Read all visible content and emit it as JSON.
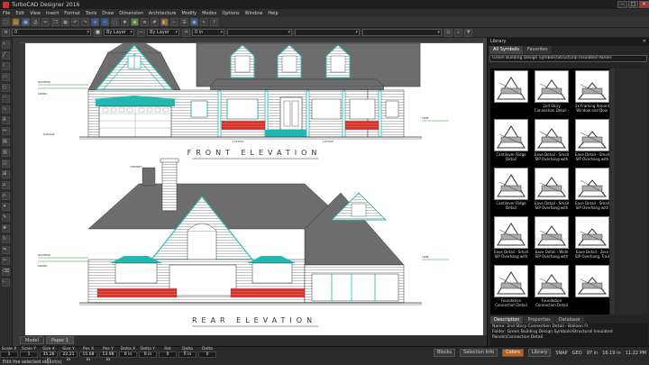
{
  "app": {
    "title": "TurboCAD Designer 2016",
    "window_buttons": [
      "–",
      "□",
      "✕"
    ]
  },
  "menu": [
    "File",
    "Edit",
    "View",
    "Insert",
    "Format",
    "Tools",
    "Draw",
    "Dimension",
    "Architecture",
    "Modify",
    "Modes",
    "Options",
    "Window",
    "Help"
  ],
  "toolbar2": {
    "layer_value": "0",
    "color_value": "By Layer",
    "linetype_value": "By Layer",
    "width_value": "0 in"
  },
  "drawing": {
    "front_title": "FRONT ELEVATION",
    "rear_title": "REAR ELEVATION"
  },
  "page_tabs": [
    "Model",
    "Paper 1"
  ],
  "library": {
    "title": "Library",
    "tabs": [
      "All Symbols",
      "Favorites"
    ],
    "path": "Green Building Design Symbols\\Structural Insulated Panels",
    "items": [
      {
        "label": "",
        "selected": false
      },
      {
        "label": "2nd Story Connection Detail - Standard",
        "selected": false
      },
      {
        "label": "2x Framing Around Window and Door",
        "selected": false
      },
      {
        "label": "Cantilever Ridge Detail",
        "selected": false
      },
      {
        "label": "Eave Detail - Small SIP Overhang with",
        "selected": false
      },
      {
        "label": "Eave Detail - Small SIP Overhang with",
        "selected": false
      },
      {
        "label": "Cantilever Ridge Detail",
        "selected": false
      },
      {
        "label": "Eave Detail - Small SIP Overhang with",
        "selected": false
      },
      {
        "label": "Eave Detail - Small SIP Overhang with",
        "selected": false
      },
      {
        "label": "Eave Detail - Small SIP Overhang with",
        "selected": false
      },
      {
        "label": "Eave Detail - Wide SIP Overhang with",
        "selected": false
      },
      {
        "label": "Eave Detail - Zero SIP Overhang, Trad",
        "selected": false
      },
      {
        "label": "Foundation Connection Detail",
        "selected": false
      },
      {
        "label": "Foundation Connection Detail",
        "selected": false
      },
      {
        "label": "",
        "selected": false
      }
    ],
    "bottom_tabs": [
      "Description",
      "Properties",
      "Database"
    ],
    "desc_name_label": "Name:",
    "desc_name_value": "2nd Story Connection Detail - Balloon Fr",
    "desc_folder_label": "Folder:",
    "desc_folder_value": "Green Building Design Symbols\\Structural Insulated Panels\\Connection Detail"
  },
  "status": {
    "coords": [
      {
        "label": "Scale X",
        "value": "1"
      },
      {
        "label": "Scale Y",
        "value": "1"
      },
      {
        "label": "Size X",
        "value": "35.26 in"
      },
      {
        "label": "Size Y",
        "value": "22.21 in"
      },
      {
        "label": "Pos X",
        "value": "15.68 in"
      },
      {
        "label": "Pos Y",
        "value": "13.98 in"
      },
      {
        "label": "Delta X",
        "value": "0 in"
      },
      {
        "label": "Delta Y",
        "value": "0 in"
      },
      {
        "label": "Rot",
        "value": "0"
      },
      {
        "label": "Delta Dist",
        "value": "0 in"
      },
      {
        "label": "Delta Ang",
        "value": "0"
      }
    ],
    "hint": "Edit the selected object(s)",
    "snap": "SNAP",
    "geo": "GEO",
    "zoom": "97 in",
    "zoom2": "16.19 in",
    "time": "11:22 PM",
    "task_tabs": [
      "Blocks",
      "Selection Info",
      "Colors",
      "Library"
    ]
  }
}
